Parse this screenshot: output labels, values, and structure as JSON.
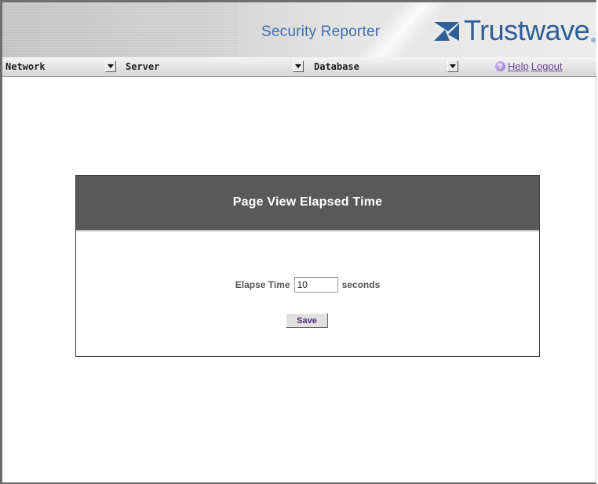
{
  "header": {
    "app_title": "Security Reporter",
    "brand": "Trustwave",
    "brand_mark": "®"
  },
  "navbar": {
    "menus": [
      {
        "label": "Network",
        "icon": "dropdown-arrow-icon"
      },
      {
        "label": "Server",
        "icon": "dropdown-arrow-icon"
      },
      {
        "label": "Database",
        "icon": "dropdown-arrow-icon"
      }
    ],
    "help_label": "Help",
    "logout_label": "Logout"
  },
  "panel": {
    "title": "Page View Elapsed Time",
    "field_label": "Elapse Time",
    "field_value": "10",
    "field_unit": "seconds",
    "save_label": "Save"
  },
  "colors": {
    "brand": "#2f5f97",
    "app_title": "#3b6fb3",
    "panel_header": "#595959",
    "link": "#6a4a9a"
  }
}
